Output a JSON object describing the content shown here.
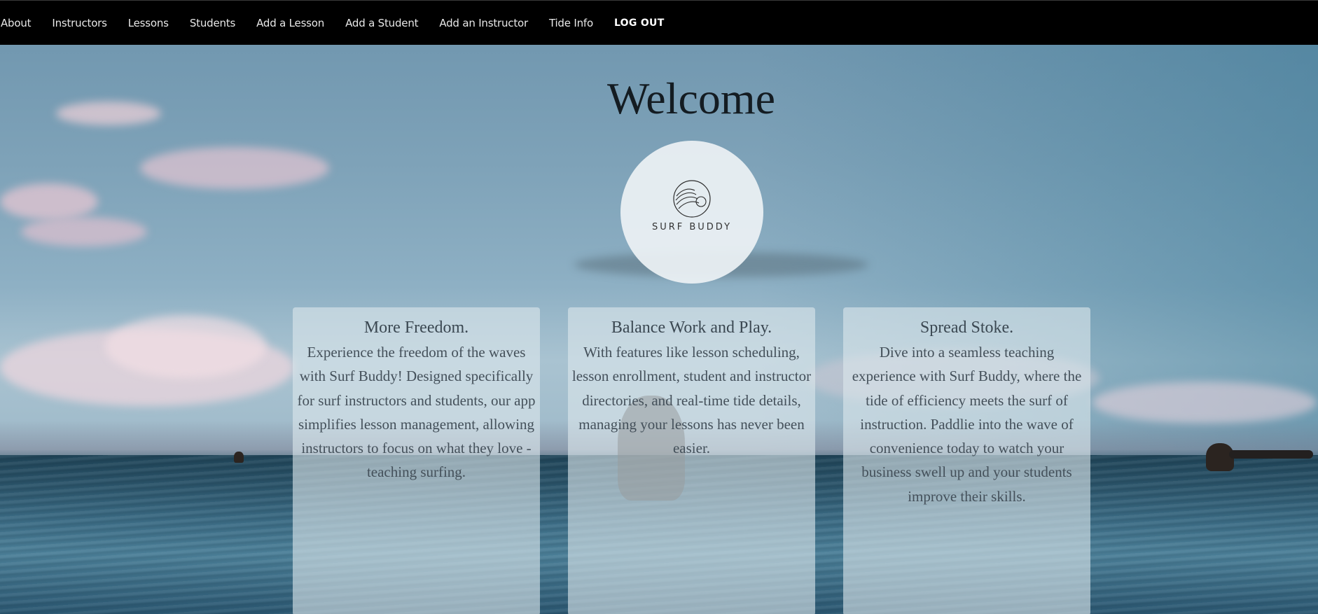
{
  "nav": {
    "links": [
      "About",
      "Instructors",
      "Lessons",
      "Students",
      "Add a Lesson",
      "Add a Student",
      "Add an Instructor",
      "Tide Info"
    ],
    "logout": "LOG OUT"
  },
  "main": {
    "heading": "Welcome",
    "logo": {
      "text": "SURF BUDDY",
      "icon": "wave-sun-icon"
    },
    "cards": [
      {
        "title": "More Freedom.",
        "body": "Experience the freedom of the waves with Surf Buddy! Designed specifically for surf instructors and students, our app simplifies lesson management, allowing instructors to focus on what they love - teaching surfing."
      },
      {
        "title": "Balance Work and Play.",
        "body": "With features like lesson scheduling, lesson enrollment, student and instructor directories, and real-time tide details, managing your lessons has never been easier."
      },
      {
        "title": "Spread Stoke.",
        "body": "Dive into a seamless teaching experience with Surf Buddy, where the tide of efficiency meets the surf of instruction. Paddlie into the wave of convenience today to watch your business swell up and your students improve their skills."
      }
    ]
  },
  "colors": {
    "navbar": "#000000",
    "heading": "#141c22",
    "card_background": "rgba(220,230,236,0.62)"
  }
}
